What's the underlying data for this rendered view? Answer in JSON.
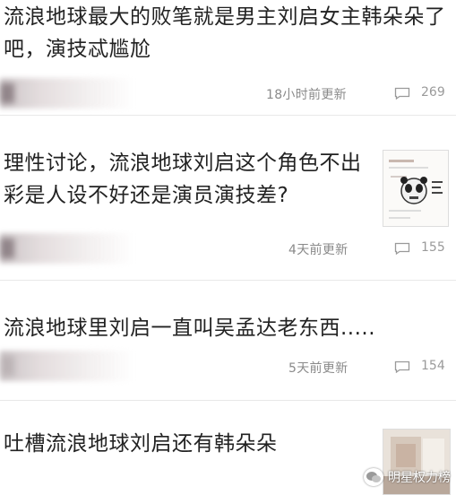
{
  "threads": [
    {
      "title_line1": "流浪地球最大的败笔就是男主刘启女主韩朵朵了",
      "title_line2": "吧，演技忒尴尬",
      "time": "18小时前更新",
      "comments": "269"
    },
    {
      "title_line1": "理性讨论，流浪地球刘启这个角色不出",
      "title_line2": "彩是人设不好还是演员演技差?",
      "time": "4天前更新",
      "comments": "155"
    },
    {
      "title_line1": "流浪地球里刘启一直叫吴孟达老东西.....",
      "time": "5天前更新",
      "comments": "154"
    },
    {
      "title_line1": "吐槽流浪地球刘启还有韩朵朵"
    }
  ],
  "watermark": {
    "text": "明星权力榜"
  },
  "icons": {
    "comment": "comment-icon",
    "watermark": "wechat-icon"
  },
  "colors": {
    "title": "#222222",
    "meta": "#8a8a8a",
    "divider": "#e8e8e8"
  }
}
